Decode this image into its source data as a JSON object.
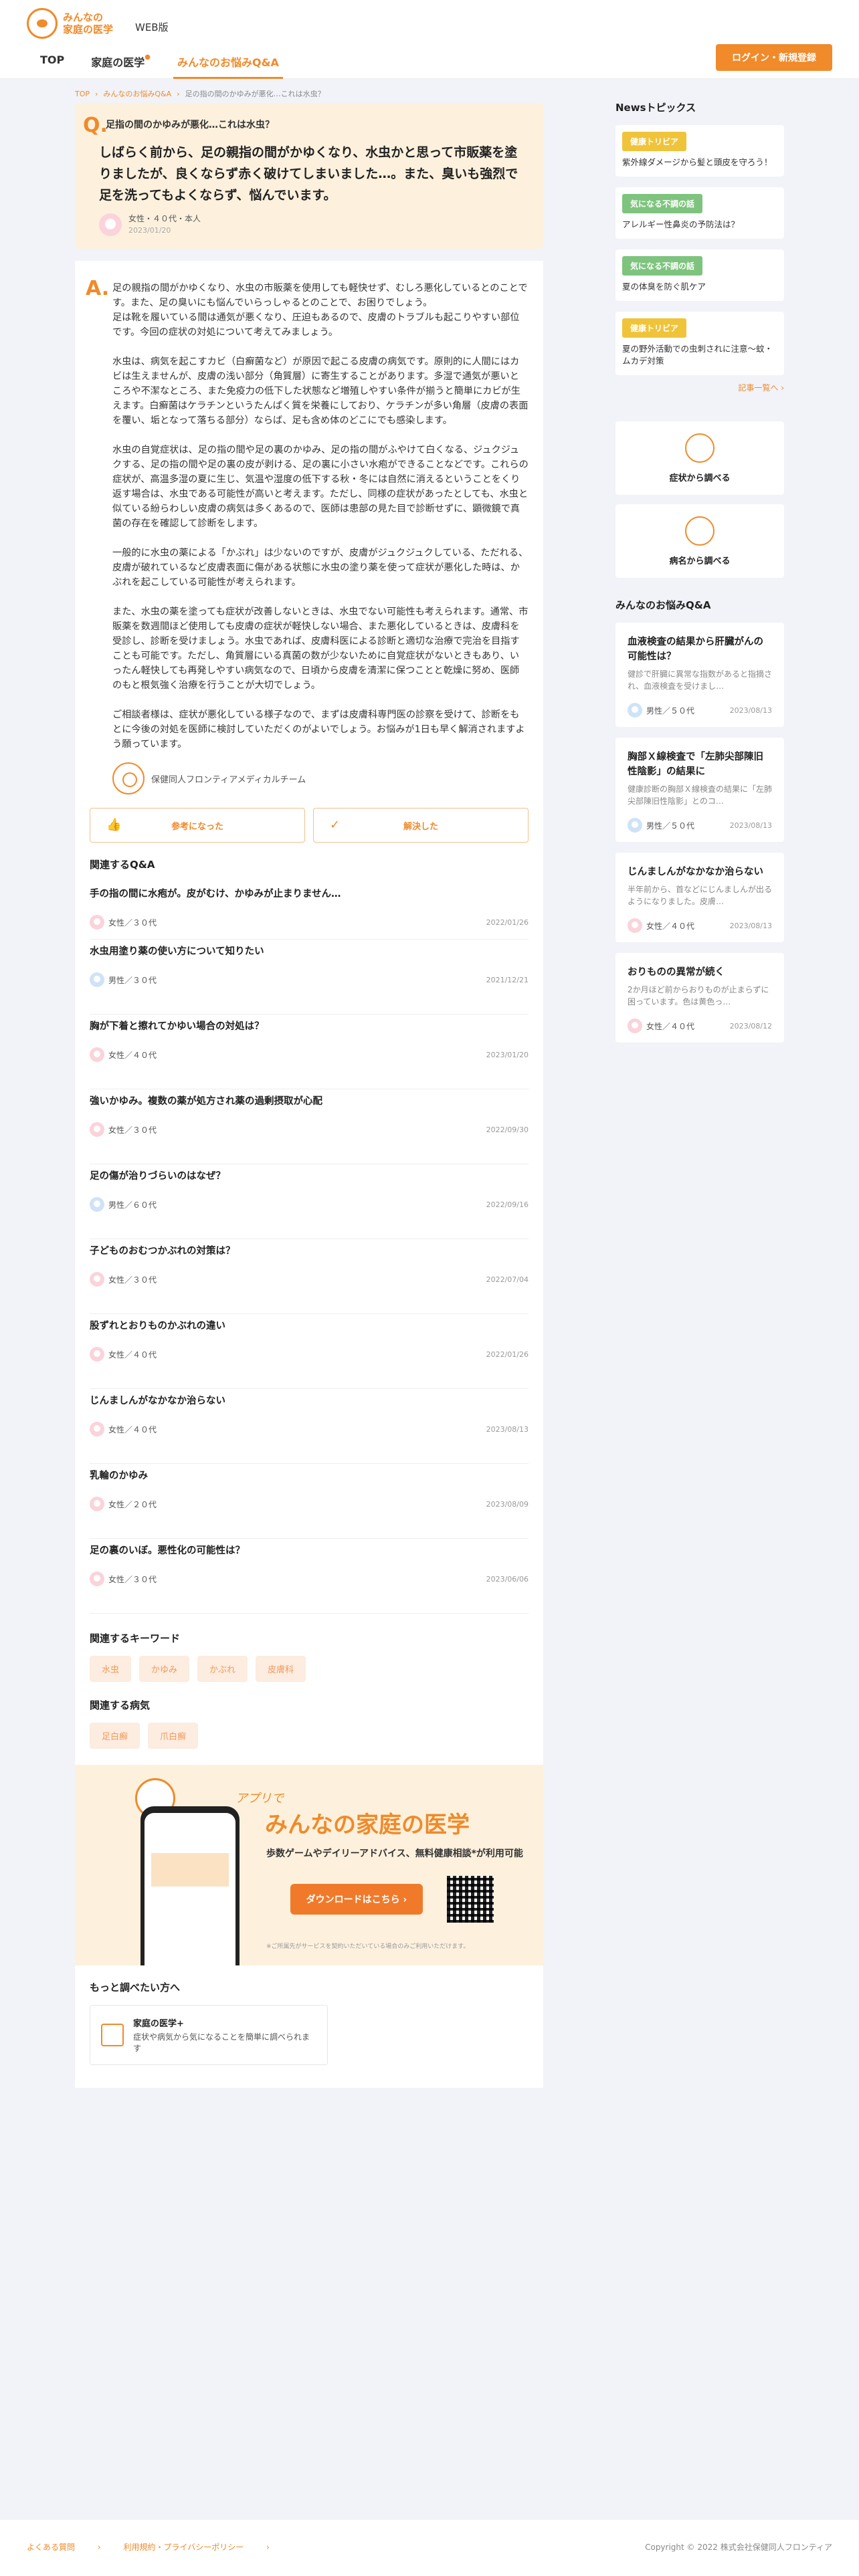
{
  "header": {
    "logo_line1": "みんなの",
    "logo_line2": "家庭の医学",
    "web_badge": "WEB版",
    "nav": [
      {
        "label": "TOP"
      },
      {
        "label": "家庭の医学"
      },
      {
        "label": "みんなのお悩みQ&A"
      }
    ],
    "login_label": "ログイン・新規登録"
  },
  "breadcrumb": [
    "TOP",
    "みんなのお悩みQ&A",
    "足の指の間のかゆみが悪化…これは水虫？"
  ],
  "question": {
    "mark": "Q.",
    "title": "足指の間のかゆみが悪化…これは水虫？",
    "body": "しばらく前から、足の親指の間がかゆくなり、水虫かと思って市販薬を塗りましたが、良くならず赤く破けてしまいました…。また、臭いも強烈で足を洗ってもよくならず、悩んでいます。",
    "user": "女性・４０代・本人",
    "date": "2023/01/20"
  },
  "answer": {
    "mark": "A.",
    "paragraphs": [
      "足の親指の間がかゆくなり、水虫の市販薬を使用しても軽快せず、むしろ悪化しているとのことです。また、足の臭いにも悩んでいらっしゃるとのことで、お困りでしょう。\n足は靴を履いている間は通気が悪くなり、圧迫もあるので、皮膚のトラブルも起こりやすい部位です。今回の症状の対処について考えてみましょう。",
      "水虫は、病気を起こすカビ（白癬菌など）が原因で起こる皮膚の病気です。原則的に人間にはカビは生えませんが、皮膚の浅い部分（角質層）に寄生することがあります。多湿で通気が悪いところや不潔なところ、また免疫力の低下した状態など増殖しやすい条件が揃うと簡単にカビが生えます。白癬菌はケラチンというたんぱく質を栄養にしており、ケラチンが多い角層（皮膚の表面を覆い、垢となって落ちる部分）ならば、足も含め体のどこにでも感染します。",
      "水虫の自覚症状は、足の指の間や足の裏のかゆみ、足の指の間がふやけて白くなる、ジュクジュクする、足の指の間や足の裏の皮が剥ける、足の裏に小さい水疱ができることなどです。これらの症状が、高温多湿の夏に生じ、気温や湿度の低下する秋・冬には自然に消えるということをくり返す場合は、水虫である可能性が高いと考えます。ただし、同様の症状があったとしても、水虫と似ている紛らわしい皮膚の病気は多くあるので、医師は患部の見た目で診断せずに、顕微鏡で真菌の存在を確認して診断をします。",
      "一般的に水虫の薬による「かぶれ」は少ないのですが、皮膚がジュクジュクしている、ただれる、皮膚が破れているなど皮膚表面に傷がある状態に水虫の塗り薬を使って症状が悪化した時は、かぶれを起こしている可能性が考えられます。",
      "また、水虫の薬を塗っても症状が改善しないときは、水虫でない可能性も考えられます。通常、市販薬を数週間ほど使用しても皮膚の症状が軽快しない場合、また悪化しているときは、皮膚科を受診し、診断を受けましょう。水虫であれば、皮膚科医による診断と適切な治療で完治を目指すことも可能です。ただし、角質層にいる真菌の数が少ないために自覚症状がないときもあり、いったん軽快しても再発しやすい病気なので、日頃から皮膚を清潔に保つことと乾燥に努め、医師のもと根気強く治療を行うことが大切でしょう。",
      "ご相談者様は、症状が悪化している様子なので、まずは皮膚科専門医の診察を受けて、診断をもとに今後の対処を医師に検討していただくのがよいでしょう。お悩みが1日も早く解消されますよう願っています。"
    ],
    "author": "保健同人フロンティアメディカルチーム",
    "helpful_label": "参考になった",
    "solved_label": "解決した"
  },
  "related": {
    "title": "関連するQ&A",
    "items": [
      {
        "q": "手の指の間に水疱が。皮がむけ、かゆみが止まりません…",
        "user": "女性／３０代",
        "gender": "f",
        "date": "2022/01/26"
      },
      {
        "q": "水虫用塗り薬の使い方について知りたい",
        "user": "男性／３０代",
        "gender": "m",
        "date": "2021/12/21"
      },
      {
        "q": "胸が下着と擦れてかゆい場合の対処は？",
        "user": "女性／４０代",
        "gender": "f",
        "date": "2023/01/20"
      },
      {
        "q": "強いかゆみ。複数の薬が処方され薬の過剰摂取が心配",
        "user": "女性／３０代",
        "gender": "f",
        "date": "2022/09/30"
      },
      {
        "q": "足の傷が治りづらいのはなぜ？",
        "user": "男性／６０代",
        "gender": "m",
        "date": "2022/09/16"
      },
      {
        "q": "子どものおむつかぶれの対策は？",
        "user": "女性／３０代",
        "gender": "f",
        "date": "2022/07/04"
      },
      {
        "q": "股ずれとおりものかぶれの違い",
        "user": "女性／４０代",
        "gender": "f",
        "date": "2022/01/26"
      },
      {
        "q": "じんましんがなかなか治らない",
        "user": "女性／４０代",
        "gender": "f",
        "date": "2023/08/13"
      },
      {
        "q": "乳輪のかゆみ",
        "user": "女性／２０代",
        "gender": "f",
        "date": "2023/08/09"
      },
      {
        "q": "足の裏のいぼ。悪性化の可能性は？",
        "user": "女性／３０代",
        "gender": "f",
        "date": "2023/06/06"
      }
    ]
  },
  "keywords": {
    "title": "関連するキーワード",
    "items": [
      "水虫",
      "かゆみ",
      "かぶれ",
      "皮膚科"
    ]
  },
  "diseases": {
    "title": "関連する病気",
    "items": [
      "足白癬",
      "爪白癬"
    ]
  },
  "app_banner": {
    "script": "アプリで",
    "title": "みんなの家庭の医学",
    "sub": "歩数ゲームやデイリーアドバイス、無料健康相談*が利用可能",
    "download": "ダウンロードはこちら",
    "note": "※ご所属先がサービスを契約いただいている場合のみご利用いただけます。"
  },
  "more": {
    "title": "もっと調べたい方へ",
    "card_title": "家庭の医学+",
    "card_desc": "症状や病気から気になることを簡単に調べられます"
  },
  "sidebar": {
    "news_title": "Newsトピックス",
    "news": [
      {
        "badge": "健康トリビア",
        "color": "y",
        "text": "紫外線ダメージから髪と頭皮を守ろう！"
      },
      {
        "badge": "気になる不調の話",
        "color": "g",
        "text": "アレルギー性鼻炎の予防法は？"
      },
      {
        "badge": "気になる不調の話",
        "color": "g",
        "text": "夏の体臭を防ぐ肌ケア"
      },
      {
        "badge": "健康トリビア",
        "color": "y",
        "text": "夏の野外活動での虫刺されに注意〜蚊・ムカデ対策"
      }
    ],
    "news_more": "記事一覧へ",
    "search_symptom": "症状から調べる",
    "search_disease": "病名から調べる",
    "qa_title": "みんなのお悩みQ&A",
    "qa": [
      {
        "t": "血液検査の結果から肝臓がんの可能性は？",
        "d": "健診で肝臓に異常な指数があると指摘され、血液検査を受けまし…",
        "user": "男性／５０代",
        "gender": "m",
        "date": "2023/08/13"
      },
      {
        "t": "胸部Ｘ線検査で「左肺尖部陳旧性陰影」の結果に",
        "d": "健康診断の胸部Ｘ線検査の結果に「左肺尖部陳旧性陰影」とのコ…",
        "user": "男性／５０代",
        "gender": "m",
        "date": "2023/08/13"
      },
      {
        "t": "じんましんがなかなか治らない",
        "d": "半年前から、首などにじんましんが出るようになりました。皮膚…",
        "user": "女性／４０代",
        "gender": "f",
        "date": "2023/08/13"
      },
      {
        "t": "おりものの異常が続く",
        "d": "2か月ほど前からおりものが止まらずに困っています。色は黄色っ…",
        "user": "女性／４０代",
        "gender": "f",
        "date": "2023/08/12"
      }
    ]
  },
  "footer": {
    "faq": "よくある質問",
    "terms": "利用規約・プライバシーポリシー",
    "copyright": "Copyright © 2022 株式会社保健同人フロンティア"
  }
}
